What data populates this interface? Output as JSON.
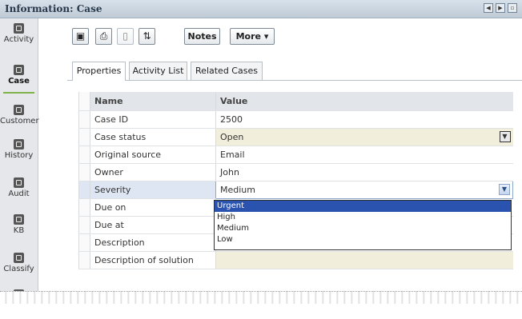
{
  "window": {
    "title": "Information: Case"
  },
  "sidebar": {
    "items": [
      {
        "label": "Activity",
        "icon": "activity-icon"
      },
      {
        "label": "Case",
        "icon": "case-icon",
        "active": true
      },
      {
        "label": "Customer",
        "icon": "customer-icon"
      },
      {
        "label": "History",
        "icon": "history-icon"
      },
      {
        "label": "Audit",
        "icon": "audit-icon"
      },
      {
        "label": "KB",
        "icon": "kb-icon"
      },
      {
        "label": "Classify",
        "icon": "classify-icon"
      }
    ]
  },
  "toolbar": {
    "notes_label": "Notes",
    "more_label": "More",
    "more_arrow": "▾",
    "icons": [
      "save-icon",
      "print-icon",
      "attach-icon",
      "refresh-icon"
    ]
  },
  "tabs": [
    {
      "label": "Properties",
      "active": true
    },
    {
      "label": "Activity List"
    },
    {
      "label": "Related Cases"
    }
  ],
  "grid": {
    "headers": {
      "name": "Name",
      "value": "Value"
    },
    "rows": [
      {
        "name": "Case ID",
        "value": "2500"
      },
      {
        "name": "Case status",
        "value": "Open"
      },
      {
        "name": "Original source",
        "value": "Email"
      },
      {
        "name": "Owner",
        "value": "John"
      },
      {
        "name": "Severity",
        "value": "Medium"
      },
      {
        "name": "Due on",
        "value": ""
      },
      {
        "name": "Due at",
        "value": ""
      },
      {
        "name": "Description",
        "value": ""
      },
      {
        "name": "Description of solution",
        "value": ""
      }
    ]
  },
  "severity_options": [
    "Urgent",
    "High",
    "Medium",
    "Low"
  ],
  "severity_highlighted": "Urgent",
  "colors": {
    "accent": "#7fb24a",
    "selection": "#2a53b0",
    "header_bg": "#e2e6ea",
    "editable_bg": "#f1efdc"
  }
}
